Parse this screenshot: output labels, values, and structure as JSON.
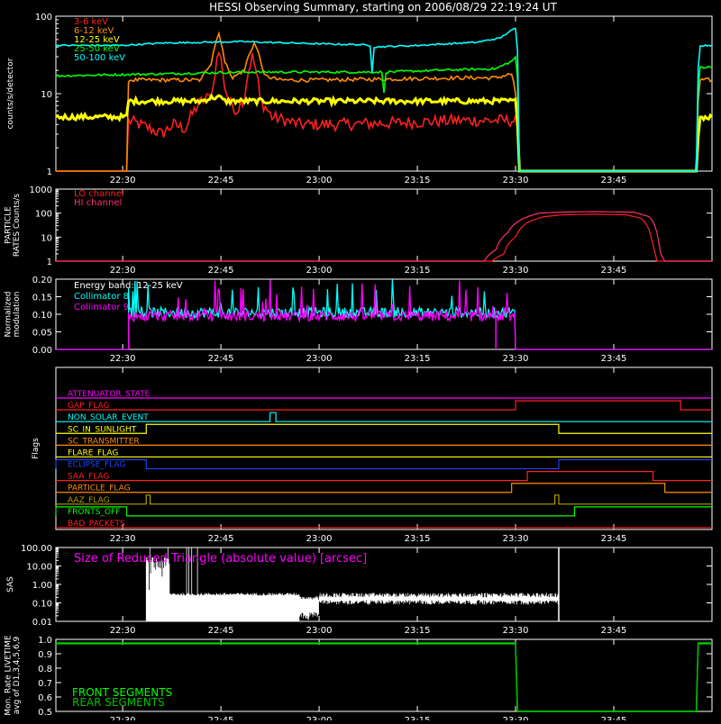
{
  "title": "HESSI Observing Summary, starting on 2006/08/29 22:19:24 UT",
  "time_ticks": [
    "22:30",
    "22:45",
    "23:00",
    "23:15",
    "23:30",
    "23:45"
  ],
  "colors": {
    "background": "#000000",
    "axes": "#ffffff",
    "red": "#ff2020",
    "orange": "#ff8c00",
    "yellow": "#ffff00",
    "green": "#00ff00",
    "cyan": "#00ffff",
    "magenta": "#ff00ff",
    "blue": "#2040ff",
    "olive": "#b0a000",
    "white": "#ffffff"
  },
  "chart_data": [
    {
      "type": "line",
      "name": "count-rates",
      "ylabel": "counts/s/detector",
      "yscale": "log",
      "ylim": [
        1,
        100
      ],
      "yticks": [
        "1",
        "10",
        "100"
      ],
      "legend": [
        "3-6 keV",
        "6-12 keV",
        "12-25 keV",
        "25-50 keV",
        "50-100 keV"
      ],
      "legend_colors": [
        "#ff2020",
        "#ff8c00",
        "#ffff00",
        "#00ff00",
        "#00ffff"
      ],
      "series": [
        {
          "name": "3-6 keV",
          "color": "#ff2020",
          "points": [
            [
              22.33,
              1
            ],
            [
              22.51,
              1
            ],
            [
              22.515,
              4.5
            ],
            [
              22.6,
              3
            ],
            [
              22.63,
              4
            ],
            [
              22.66,
              3.5
            ],
            [
              22.7,
              8
            ],
            [
              22.72,
              9
            ],
            [
              22.73,
              12
            ],
            [
              22.745,
              35
            ],
            [
              22.76,
              12
            ],
            [
              22.77,
              8
            ],
            [
              22.79,
              6
            ],
            [
              22.81,
              9
            ],
            [
              22.83,
              30
            ],
            [
              22.85,
              8
            ],
            [
              22.88,
              5
            ],
            [
              22.95,
              4
            ],
            [
              23.05,
              4
            ],
            [
              23.2,
              4.2
            ],
            [
              23.35,
              4.5
            ],
            [
              23.45,
              4.5
            ],
            [
              23.5,
              4.5
            ],
            [
              23.51,
              1
            ],
            [
              23.95,
              1
            ]
          ]
        },
        {
          "name": "6-12 keV",
          "color": "#ff8c00",
          "points": [
            [
              22.33,
              1
            ],
            [
              22.51,
              1
            ],
            [
              22.515,
              15
            ],
            [
              22.6,
              15
            ],
            [
              22.7,
              15
            ],
            [
              22.725,
              25
            ],
            [
              22.745,
              60
            ],
            [
              22.76,
              25
            ],
            [
              22.78,
              16
            ],
            [
              22.81,
              20
            ],
            [
              22.835,
              45
            ],
            [
              22.86,
              17
            ],
            [
              22.9,
              15
            ],
            [
              23.0,
              15
            ],
            [
              23.2,
              15.5
            ],
            [
              23.35,
              16
            ],
            [
              23.45,
              16
            ],
            [
              23.49,
              18
            ],
            [
              23.51,
              1
            ],
            [
              23.96,
              1
            ],
            [
              23.97,
              15
            ],
            [
              24.0,
              15
            ]
          ]
        },
        {
          "name": "12-25 keV",
          "color": "#ffff00",
          "points": [
            [
              22.33,
              5
            ],
            [
              22.51,
              5
            ],
            [
              22.515,
              8
            ],
            [
              22.7,
              8
            ],
            [
              22.73,
              9
            ],
            [
              22.745,
              9
            ],
            [
              22.76,
              8
            ],
            [
              22.9,
              8
            ],
            [
              23.1,
              8
            ],
            [
              23.3,
              8
            ],
            [
              23.45,
              8
            ],
            [
              23.5,
              8
            ],
            [
              23.51,
              1
            ],
            [
              23.96,
              1
            ],
            [
              23.97,
              5
            ],
            [
              24.0,
              5
            ]
          ]
        },
        {
          "name": "25-50 keV",
          "color": "#00ff00",
          "points": [
            [
              22.33,
              17
            ],
            [
              22.6,
              18
            ],
            [
              22.8,
              19
            ],
            [
              23.0,
              19
            ],
            [
              23.16,
              19
            ],
            [
              23.165,
              10
            ],
            [
              23.17,
              19
            ],
            [
              23.3,
              20
            ],
            [
              23.45,
              21
            ],
            [
              23.49,
              26
            ],
            [
              23.5,
              30
            ],
            [
              23.51,
              1
            ],
            [
              23.96,
              1
            ],
            [
              23.97,
              22
            ],
            [
              24.0,
              22
            ]
          ]
        },
        {
          "name": "50-100 keV",
          "color": "#00ffff",
          "points": [
            [
              22.33,
              42
            ],
            [
              22.5,
              42
            ],
            [
              22.6,
              45
            ],
            [
              22.8,
              47
            ],
            [
              23.0,
              44
            ],
            [
              23.1,
              43
            ],
            [
              23.13,
              42
            ],
            [
              23.135,
              19
            ],
            [
              23.14,
              40
            ],
            [
              23.25,
              42
            ],
            [
              23.4,
              46
            ],
            [
              23.46,
              52
            ],
            [
              23.5,
              70
            ],
            [
              23.51,
              1
            ],
            [
              23.96,
              1
            ],
            [
              23.97,
              42
            ],
            [
              24.0,
              42
            ]
          ]
        }
      ]
    },
    {
      "type": "line",
      "name": "particle-rates",
      "ylabel": "PARTICLE RATES Counts/s",
      "yscale": "log",
      "ylim": [
        1,
        1000
      ],
      "yticks": [
        "1",
        "10",
        "100",
        "1000"
      ],
      "legend": [
        "LO channel",
        "HI channel"
      ],
      "legend_colors": [
        "#ff2020",
        "#ff3070"
      ],
      "series": [
        {
          "name": "LO channel",
          "color": "#ff2020",
          "points": [
            [
              22.33,
              1
            ],
            [
              23.44,
              1
            ],
            [
              23.47,
              2
            ],
            [
              23.5,
              10
            ],
            [
              23.53,
              40
            ],
            [
              23.57,
              70
            ],
            [
              23.62,
              85
            ],
            [
              23.7,
              90
            ],
            [
              23.78,
              85
            ],
            [
              23.82,
              60
            ],
            [
              23.84,
              20
            ],
            [
              23.85,
              5
            ],
            [
              23.86,
              1
            ],
            [
              24.0,
              1
            ]
          ]
        },
        {
          "name": "HI channel",
          "color": "#ff3070",
          "points": [
            [
              22.33,
              1
            ],
            [
              23.42,
              1
            ],
            [
              23.45,
              3
            ],
            [
              23.48,
              15
            ],
            [
              23.52,
              60
            ],
            [
              23.56,
              100
            ],
            [
              23.62,
              110
            ],
            [
              23.7,
              115
            ],
            [
              23.8,
              110
            ],
            [
              23.84,
              70
            ],
            [
              23.86,
              15
            ],
            [
              23.87,
              2
            ],
            [
              23.88,
              1
            ],
            [
              24.0,
              1
            ]
          ]
        }
      ]
    },
    {
      "type": "line",
      "name": "modulation",
      "ylabel": "Normalized modulation",
      "ylim": [
        0,
        0.2
      ],
      "yticks": [
        "0.00",
        "0.05",
        "0.10",
        "0.15",
        "0.20"
      ],
      "annotation": "Energy band: 12-25 keV",
      "legend": [
        "Collimator 8",
        "Collimator 9"
      ],
      "legend_colors": [
        "#00ffff",
        "#ff00ff"
      ],
      "series": [
        {
          "name": "Collimator 8",
          "color": "#00ffff",
          "start": 22.515,
          "end": 23.5,
          "mean": 0.105,
          "peak": 0.2
        },
        {
          "name": "Collimator 9",
          "color": "#ff00ff",
          "start": 22.515,
          "end": 23.5,
          "mean": 0.095,
          "peak": 0.2
        }
      ]
    },
    {
      "type": "line",
      "name": "flags",
      "ylabel": "Flags",
      "series": [
        {
          "name": "ATTENUATOR_STATE",
          "color": "#ff00ff",
          "steps": []
        },
        {
          "name": "GAP_FLAG",
          "color": "#ff2020",
          "steps": [
            [
              23.5,
              23.92
            ]
          ]
        },
        {
          "name": "NON_SOLAR_EVENT",
          "color": "#00ffff",
          "steps": [
            [
              22.875,
              22.89
            ]
          ]
        },
        {
          "name": "SC_IN_SUNLIGHT",
          "color": "#ffff00",
          "steps": [
            [
              22.56,
              23.61
            ]
          ]
        },
        {
          "name": "SC_TRANSMITTER",
          "color": "#ff8c00",
          "steps": []
        },
        {
          "name": "FLARE_FLAG",
          "color": "#ffff00",
          "steps": []
        },
        {
          "name": "ECLIPSE_FLAG",
          "color": "#2040ff",
          "steps": [
            [
              22.33,
              22.56
            ],
            [
              23.61,
              24.0
            ]
          ]
        },
        {
          "name": "SAA_FLAG",
          "color": "#ff2020",
          "steps": [
            [
              23.53,
              23.85
            ]
          ]
        },
        {
          "name": "PARTICLE_FLAG",
          "color": "#ff8c00",
          "steps": [
            [
              23.49,
              23.88
            ]
          ]
        },
        {
          "name": "AAZ_FLAG",
          "color": "#b0a000",
          "steps": [
            [
              22.56,
              22.57
            ],
            [
              23.6,
              23.61
            ]
          ]
        },
        {
          "name": "FRONTS_OFF",
          "color": "#00ff00",
          "steps": [
            [
              22.33,
              22.51
            ],
            [
              23.65,
              24.0
            ]
          ]
        },
        {
          "name": "BAD_PACKETS",
          "color": "#ff2020",
          "steps": []
        }
      ]
    },
    {
      "type": "line",
      "name": "sas",
      "ylabel": "SAS",
      "yscale": "log",
      "ylim": [
        0.01,
        100
      ],
      "yticks": [
        "0.01",
        "0.10",
        "1.00",
        "10.00",
        "100.00"
      ],
      "annotation": "Size of Reduced Triangle (absolute value) [arcsec]",
      "legend_colors": [
        "#ff00ff"
      ],
      "series": [
        {
          "name": "triangle",
          "color": "#ffffff",
          "start": 22.56,
          "end": 23.61
        }
      ]
    },
    {
      "type": "line",
      "name": "livetime",
      "ylabel": "Mon. Rate LIVETIME avg of D1,3,4,5,6,9",
      "ylim": [
        0.5,
        1.0
      ],
      "yticks": [
        "0.5",
        "0.6",
        "0.7",
        "0.8",
        "0.9",
        "1.0"
      ],
      "legend": [
        "FRONT SEGMENTS",
        "REAR SEGMENTS"
      ],
      "legend_colors": [
        "#00ff00",
        "#00c000"
      ],
      "series": [
        {
          "name": "FRONT SEGMENTS",
          "color": "#00ff00",
          "points": [
            [
              22.33,
              0.97
            ],
            [
              23.5,
              0.97
            ],
            [
              23.505,
              0.5
            ],
            [
              23.96,
              0.5
            ],
            [
              23.965,
              0.97
            ],
            [
              24.0,
              0.97
            ]
          ]
        },
        {
          "name": "REAR SEGMENTS",
          "color": "#00c000",
          "points": [
            [
              22.33,
              0.975
            ],
            [
              23.5,
              0.975
            ],
            [
              23.505,
              0.5
            ],
            [
              23.96,
              0.5
            ],
            [
              23.965,
              0.975
            ],
            [
              24.0,
              0.975
            ]
          ]
        }
      ]
    }
  ]
}
